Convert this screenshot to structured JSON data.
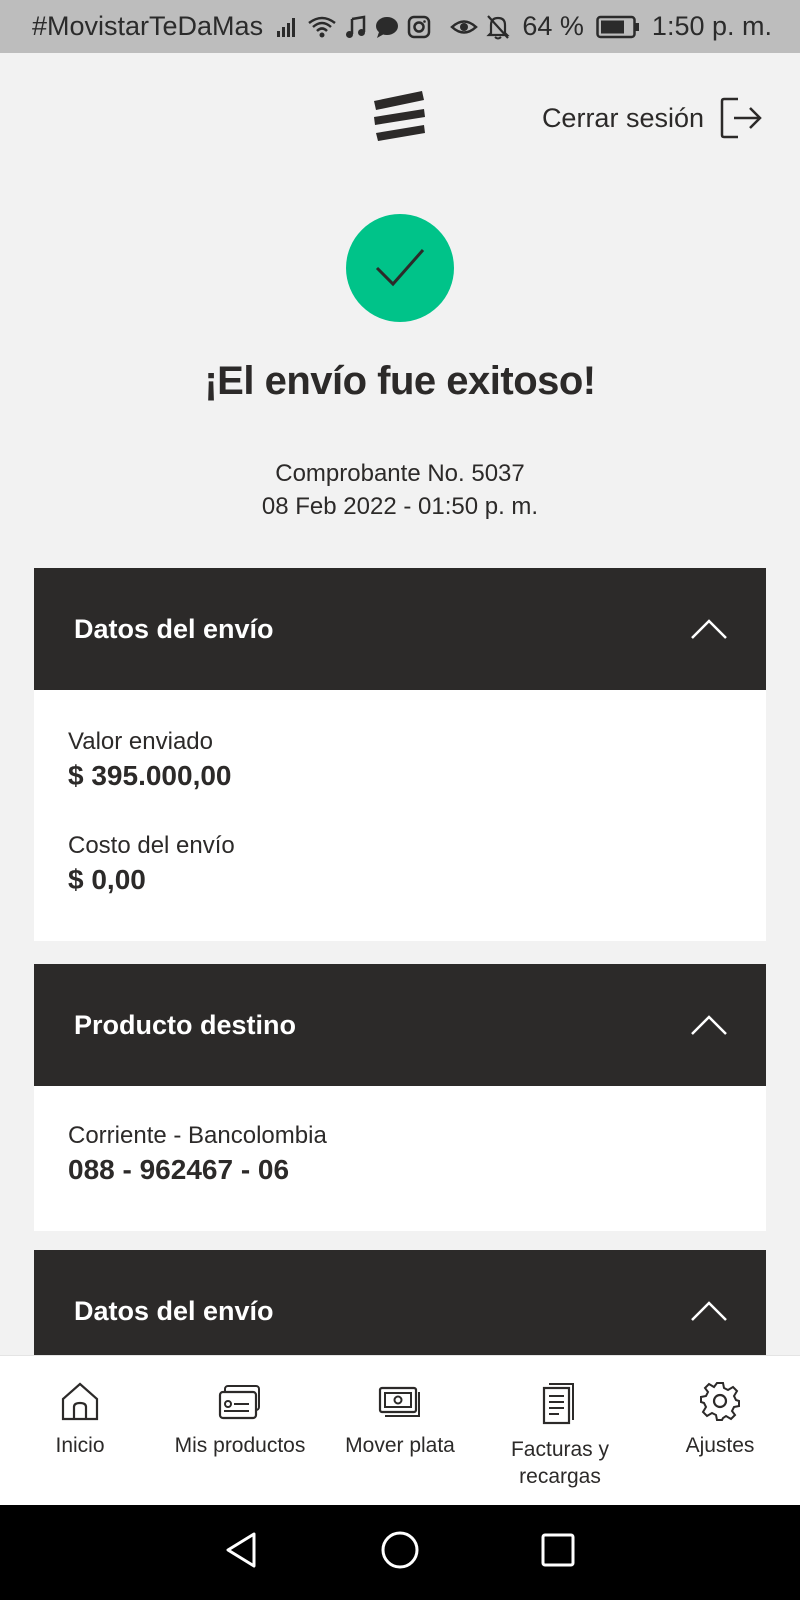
{
  "status_bar": {
    "carrier": "#MovistarTeDaMas",
    "battery": "64 %",
    "time": "1:50 p. m."
  },
  "header": {
    "logout_label": "Cerrar sesión"
  },
  "success": {
    "title": "¡El envío fue exitoso!",
    "receipt_line": "Comprobante No. 5037",
    "datetime": "08 Feb 2022 - 01:50 p. m."
  },
  "sections": [
    {
      "title": "Datos del envío",
      "fields": [
        {
          "label": "Valor enviado",
          "value": "$ 395.000,00"
        },
        {
          "label": "Costo del envío",
          "value": "$ 0,00"
        }
      ]
    },
    {
      "title": "Producto destino",
      "fields": [
        {
          "label": "Corriente - Bancolombia",
          "value": "088 - 962467 - 06"
        }
      ]
    },
    {
      "title": "Datos del envío"
    }
  ],
  "bottom_nav": {
    "items": [
      {
        "label": "Inicio",
        "icon": "home-icon"
      },
      {
        "label": "Mis productos",
        "icon": "products-card-icon"
      },
      {
        "label": "Mover plata",
        "icon": "money-transfer-icon"
      },
      {
        "label": "Facturas y recargas",
        "icon": "bills-icon"
      },
      {
        "label": "Ajustes",
        "icon": "gear-icon"
      }
    ]
  },
  "colors": {
    "accent_green": "#00c389",
    "dark_header": "#2c2a29",
    "background": "#f2f2f2"
  }
}
